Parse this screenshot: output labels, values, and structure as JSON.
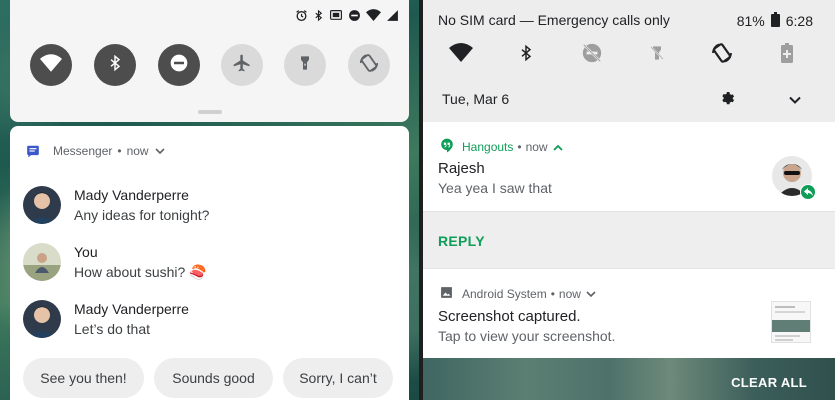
{
  "left_panel": {
    "status_icons": [
      "alarm-icon",
      "bluetooth-icon",
      "cast-icon",
      "dnd-icon",
      "wifi-icon",
      "signal-icon"
    ],
    "quick_settings": [
      {
        "name": "wifi",
        "state": "on"
      },
      {
        "name": "bluetooth",
        "state": "on"
      },
      {
        "name": "do-not-disturb",
        "state": "on"
      },
      {
        "name": "airplane",
        "state": "off"
      },
      {
        "name": "flashlight",
        "state": "off"
      },
      {
        "name": "auto-rotate",
        "state": "off"
      }
    ],
    "messenger": {
      "app_name": "Messenger",
      "separator": "•",
      "time": "now",
      "messages": [
        {
          "sender": "Mady Vanderperre",
          "text": "Any ideas for tonight?"
        },
        {
          "sender": "You",
          "text": "How about sushi? 🍣"
        },
        {
          "sender": "Mady Vanderperre",
          "text": "Let’s do that"
        }
      ],
      "smart_replies": [
        "See you then!",
        "Sounds good",
        "Sorry, I can’t"
      ]
    }
  },
  "right_panel": {
    "status": {
      "carrier": "No SIM card — Emergency calls only",
      "battery": "81%",
      "time": "6:28"
    },
    "quick_settings": [
      "wifi-icon",
      "bluetooth-icon",
      "dnd-off-icon",
      "flashlight-off-icon",
      "auto-rotate-icon",
      "battery-saver-icon"
    ],
    "date": "Tue, Mar 6",
    "hangouts": {
      "app_name": "Hangouts",
      "separator": "•",
      "time": "now",
      "title": "Rajesh",
      "text": "Yea yea I saw that",
      "reply_label": "REPLY"
    },
    "system": {
      "app_name": "Android System",
      "separator": "•",
      "time": "now",
      "title": "Screenshot captured.",
      "text": "Tap to view your screenshot."
    },
    "clear_all_label": "CLEAR ALL"
  },
  "colors": {
    "hangouts_green": "#0f9d58",
    "messenger_blue": "#3a58c9",
    "qs_on": "#4d4d4d",
    "qs_off": "#dadada"
  }
}
